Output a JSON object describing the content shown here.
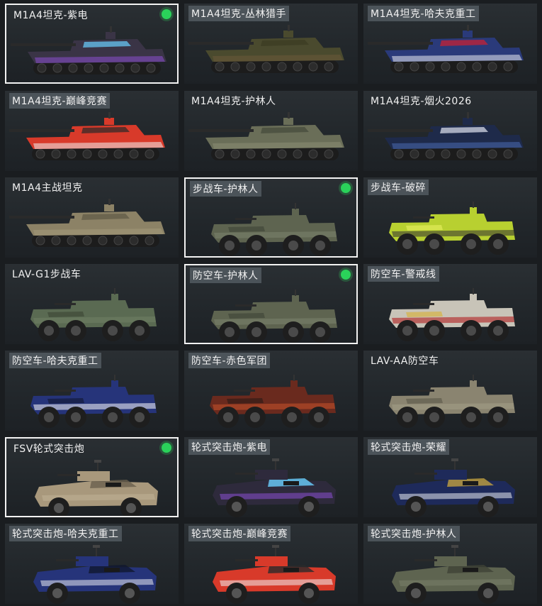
{
  "skins": [
    {
      "label": "M1A4坦克-紫电",
      "type": "tank",
      "equipped": true,
      "selected": true,
      "tag": false,
      "hull": "#3a3446",
      "accent": "#8a4fd0",
      "detail": "#6ad0ff"
    },
    {
      "label": "M1A4坦克-丛林猎手",
      "type": "tank",
      "equipped": false,
      "selected": false,
      "tag": true,
      "hull": "#4a4a2e",
      "accent": "#6b5a3a",
      "detail": "#3a3a22"
    },
    {
      "label": "M1A4坦克-哈夫克重工",
      "type": "tank",
      "equipped": false,
      "selected": false,
      "tag": true,
      "hull": "#2a3a7a",
      "accent": "#e8eaf0",
      "detail": "#d02030"
    },
    {
      "label": "M1A4坦克-巅峰竞赛",
      "type": "tank",
      "equipped": false,
      "selected": false,
      "tag": true,
      "hull": "#d83a2a",
      "accent": "#f0f0f0",
      "detail": "#2a2a2a"
    },
    {
      "label": "M1A4坦克-护林人",
      "type": "tank",
      "equipped": false,
      "selected": false,
      "tag": false,
      "hull": "#6a6e58",
      "accent": "#8a8e74",
      "detail": "#44483a"
    },
    {
      "label": "M1A4坦克-烟火2026",
      "type": "tank",
      "equipped": false,
      "selected": false,
      "tag": false,
      "hull": "#1e2a4a",
      "accent": "#4a6ab0",
      "detail": "#e0e4f0"
    },
    {
      "label": "M1A4主战坦克",
      "type": "tank",
      "equipped": false,
      "selected": false,
      "tag": false,
      "hull": "#8c8266",
      "accent": "#a49a7a",
      "detail": "#5e5846"
    },
    {
      "label": "步战车-护林人",
      "type": "ifv",
      "equipped": true,
      "selected": true,
      "tag": true,
      "hull": "#5e6450",
      "accent": "#7a806a",
      "detail": "#3e4236"
    },
    {
      "label": "步战车-破碎",
      "type": "ifv",
      "equipped": false,
      "selected": false,
      "tag": true,
      "hull": "#b8d030",
      "accent": "#3a3a30",
      "detail": "#e8f060"
    },
    {
      "label": "LAV-G1步战车",
      "type": "ifv",
      "equipped": false,
      "selected": false,
      "tag": false,
      "hull": "#5a6a52",
      "accent": "#6e7e64",
      "detail": "#3a4434"
    },
    {
      "label": "防空车-护林人",
      "type": "ifv",
      "equipped": true,
      "selected": true,
      "tag": true,
      "hull": "#5e6450",
      "accent": "#7a806a",
      "detail": "#3e4236"
    },
    {
      "label": "防空车-警戒线",
      "type": "ifv",
      "equipped": false,
      "selected": false,
      "tag": true,
      "hull": "#c8c4b8",
      "accent": "#b02020",
      "detail": "#d8b030"
    },
    {
      "label": "防空车-哈夫克重工",
      "type": "ifv",
      "equipped": false,
      "selected": false,
      "tag": true,
      "hull": "#26347a",
      "accent": "#e8eaf0",
      "detail": "#101830"
    },
    {
      "label": "防空车-赤色军团",
      "type": "ifv",
      "equipped": false,
      "selected": false,
      "tag": true,
      "hull": "#6a2a1e",
      "accent": "#c0502a",
      "detail": "#2a1a16"
    },
    {
      "label": "LAV-AA防空车",
      "type": "ifv",
      "equipped": false,
      "selected": false,
      "tag": false,
      "hull": "#8a8470",
      "accent": "#a29c86",
      "detail": "#5a5648"
    },
    {
      "label": "FSV轮式突击炮",
      "type": "fsv",
      "equipped": true,
      "selected": true,
      "tag": false,
      "hull": "#a8987c",
      "accent": "#c0b296",
      "detail": "#6a604e"
    },
    {
      "label": "轮式突击炮-紫电",
      "type": "fsv",
      "equipped": false,
      "selected": false,
      "tag": true,
      "hull": "#2e2a3c",
      "accent": "#8a4fd0",
      "detail": "#6ad0ff"
    },
    {
      "label": "轮式突击炮-荣耀",
      "type": "fsv",
      "equipped": false,
      "selected": false,
      "tag": true,
      "hull": "#1e2a5a",
      "accent": "#e8eaf0",
      "detail": "#c0a040"
    },
    {
      "label": "轮式突击炮-哈夫克重工",
      "type": "fsv",
      "equipped": false,
      "selected": false,
      "tag": true,
      "hull": "#26347a",
      "accent": "#e8eaf0",
      "detail": "#101830"
    },
    {
      "label": "轮式突击炮-巅峰竞赛",
      "type": "fsv",
      "equipped": false,
      "selected": false,
      "tag": true,
      "hull": "#d83a2a",
      "accent": "#f0f0f0",
      "detail": "#2a2a2a"
    },
    {
      "label": "轮式突击炮-护林人",
      "type": "fsv",
      "equipped": false,
      "selected": false,
      "tag": true,
      "hull": "#5e6450",
      "accent": "#7a806a",
      "detail": "#3e4236"
    }
  ]
}
